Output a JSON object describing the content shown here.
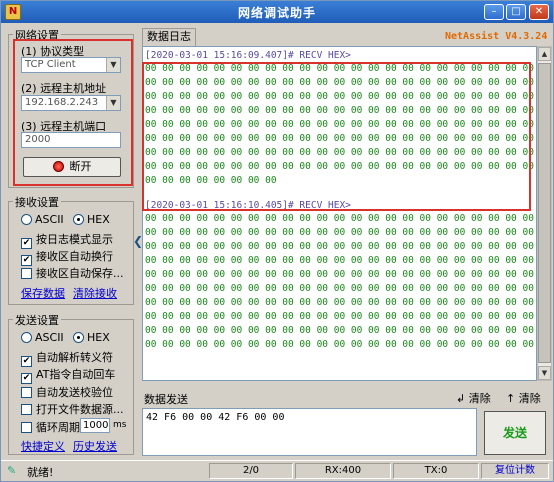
{
  "window": {
    "title": "网络调试助手",
    "brand": "NetAssist V4.3.24"
  },
  "net_settings": {
    "group_title": "网络设置",
    "protocol_label": "(1) 协议类型",
    "protocol_value": "TCP Client",
    "host_label": "(2) 远程主机地址",
    "host_value": "192.168.2.243",
    "port_label": "(3) 远程主机端口",
    "port_value": "2000",
    "disconnect_label": "断开"
  },
  "recv_settings": {
    "group_title": "接收设置",
    "ascii": "ASCII",
    "hex": "HEX",
    "log_mode": "按日志模式显示",
    "auto_newline": "接收区自动换行",
    "save_to_file": "接收区自动保存...",
    "save_data": "保存数据",
    "clear_recv": "清除接收"
  },
  "send_settings": {
    "group_title": "发送设置",
    "ascii": "ASCII",
    "hex": "HEX",
    "auto_escape": "自动解析转义符",
    "at_cr": "AT指令自动回车",
    "auto_checksum": "自动发送校验位",
    "file_source": "打开文件数据源...",
    "loop_period": "循环周期",
    "loop_value": "1000",
    "loop_unit": "ms",
    "shortcut": "快捷定义",
    "history": "历史发送"
  },
  "log": {
    "tab": "数据日志",
    "entries": [
      {
        "header": "[2020-03-01 15:16:09.407]# RECV HEX>",
        "lines": [
          "00 00 00 00 00 00 00 00 00 00 00 00 00 00 00 00 00 00 00 00 00 00 00 00 00",
          "00 00 00 00 00 00 00 00 00 00 00 00 00 00 00 00 00 00 00 00 00 00 00 00 00",
          "00 00 00 00 00 00 00 00 00 00 00 00 00 00 00 00 00 00 00 00 00 00 00 00 00",
          "00 00 00 00 00 00 00 00 00 00 00 00 00 00 00 00 00 00 00 00 00 00 00 00 00",
          "00 00 00 00 00 00 00 00 00 00 00 00 00 00 00 00 00 00 00 00 00 00 00 00 00",
          "00 00 00 00 00 00 00 00 00 00 00 00 00 00 00 00 00 00 00 00 00 00 00 00 00",
          "00 00 00 00 00 00 00 00 00 00 00 00 00 00 00 00 00 00 00 00 00 00 00 00 00",
          "00 00 00 00 00 00 00 00 00 00 00 00 00 00 00 00 00 00 00 00 00 00 00 00 00",
          "00 00 00 00 00 00 00 00"
        ]
      },
      {
        "header": "[2020-03-01 15:16:10.405]# RECV HEX>",
        "lines": [
          "00 00 00 00 00 00 00 00 00 00 00 00 00 00 00 00 00 00 00 00 00 00 00 00 00",
          "00 00 00 00 00 00 00 00 00 00 00 00 00 00 00 00 00 00 00 00 00 00 00 00 00",
          "00 00 00 00 00 00 00 00 00 00 00 00 00 00 00 00 00 00 00 00 00 00 00 00 00",
          "00 00 00 00 00 00 00 00 00 00 00 00 00 00 00 00 00 00 00 00 00 00 00 00 00",
          "00 00 00 00 00 00 00 00 00 00 00 00 00 00 00 00 00 00 00 00 00 00 00 00 00",
          "00 00 00 00 00 00 00 00 00 00 00 00 00 00 00 00 00 00 00 00 00 00 00 00 00",
          "00 00 00 00 00 00 00 00 00 00 00 00 00 00 00 00 00 00 00 00 00 00 00 00 00",
          "00 00 00 00 00 00 00 00 00 00 00 00 00 00 00 00 00 00 00 00 00 00 00 00 00",
          "00 00 00 00 00 00 00 00 00 00 00 00 00 00 00 00 00 00 00 00 00 00 00 00 00",
          "00 00 00 00 00 00 00 00 00 00 00 00 00 00 00 00 00 00 00 00 00 00 00 00 00"
        ]
      }
    ]
  },
  "send": {
    "label": "数据发送",
    "clear1": "清除",
    "clear2": "清除",
    "data": "42 F6 00 00 42 F6 00 00",
    "button": "发送"
  },
  "status": {
    "text": "就绪!",
    "counter": "2/0",
    "rx": "RX:400",
    "tx": "TX:0",
    "reset": "复位计数"
  },
  "colors": {
    "highlight": "#d9312c",
    "hex": "#1a8a1a",
    "brand": "#e06a00"
  }
}
